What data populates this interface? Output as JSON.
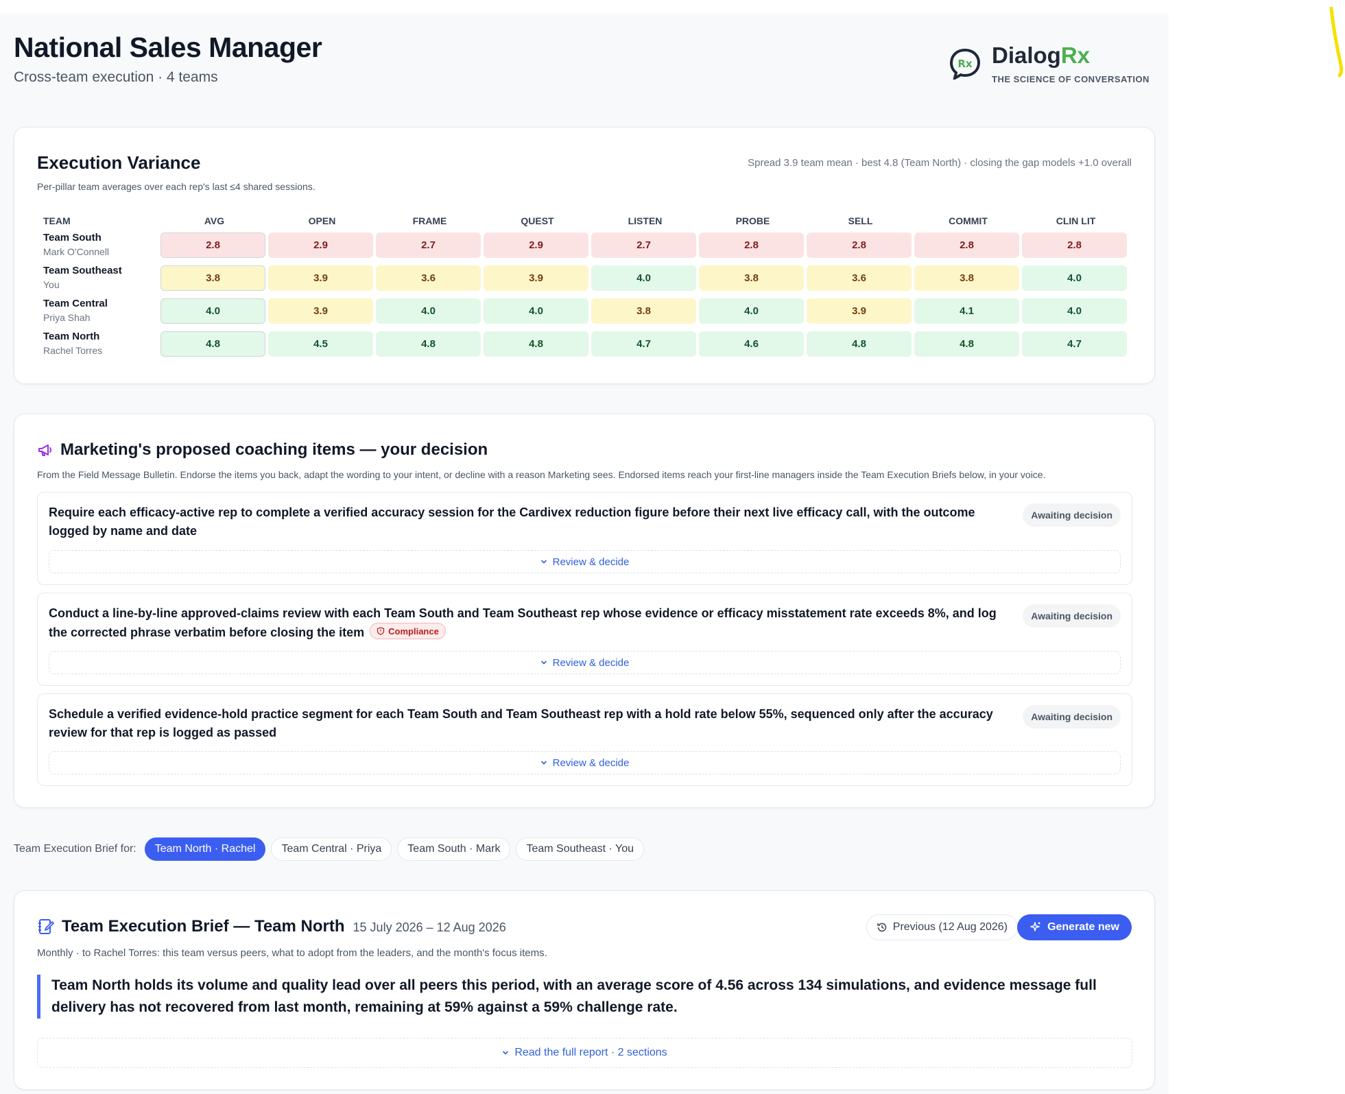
{
  "header": {
    "title": "National Sales Manager",
    "subtitle": "Cross-team execution · 4 teams",
    "logo": {
      "word_main": "Dialog",
      "word_accent": "Rx",
      "bubble_letters": "Rx",
      "tagline": "THE SCIENCE OF CONVERSATION",
      "accent_color": "#4caf50"
    }
  },
  "variance": {
    "title": "Execution Variance",
    "meta": "Spread 3.9 team mean · best 4.8 (Team North) · closing the gap models +1.0 overall",
    "description": "Per-pillar team averages over each rep's last ≤4 shared sessions.",
    "team_header": "TEAM",
    "columns": [
      "AVG",
      "OPEN",
      "FRAME",
      "QUEST",
      "LISTEN",
      "PROBE",
      "SELL",
      "COMMIT",
      "CLIN LIT"
    ],
    "rows": [
      {
        "team": "Team South",
        "manager": "Mark O'Connell",
        "values": [
          "2.8",
          "2.9",
          "2.7",
          "2.9",
          "2.7",
          "2.8",
          "2.8",
          "2.8",
          "2.8"
        ],
        "levels": [
          "r",
          "r",
          "r",
          "r",
          "r",
          "r",
          "r",
          "r",
          "r"
        ]
      },
      {
        "team": "Team Southeast",
        "manager": "You",
        "values": [
          "3.8",
          "3.9",
          "3.6",
          "3.9",
          "4.0",
          "3.8",
          "3.6",
          "3.8",
          "4.0"
        ],
        "levels": [
          "y",
          "y",
          "y",
          "y",
          "g",
          "y",
          "y",
          "y",
          "g"
        ]
      },
      {
        "team": "Team Central",
        "manager": "Priya Shah",
        "values": [
          "4.0",
          "3.9",
          "4.0",
          "4.0",
          "3.8",
          "4.0",
          "3.9",
          "4.1",
          "4.0"
        ],
        "levels": [
          "g",
          "y",
          "g",
          "g",
          "y",
          "g",
          "y",
          "g",
          "g"
        ]
      },
      {
        "team": "Team North",
        "manager": "Rachel Torres",
        "values": [
          "4.8",
          "4.5",
          "4.8",
          "4.8",
          "4.7",
          "4.6",
          "4.8",
          "4.8",
          "4.7"
        ],
        "levels": [
          "g",
          "g",
          "g",
          "g",
          "g",
          "g",
          "g",
          "g",
          "g"
        ]
      }
    ],
    "colors": {
      "low": "#fce3e3",
      "mid": "#fdf6c8",
      "high": "#e2f8e8"
    }
  },
  "marketing": {
    "icon": "megaphone-icon",
    "title": "Marketing's proposed coaching items — your decision",
    "description": "From the Field Message Bulletin. Endorse the items you back, adapt the wording to your intent, or decline with a reason Marketing sees. Endorsed items reach your first-line managers inside the Team Execution Briefs below, in your voice.",
    "items": [
      {
        "text": "Require each efficacy-active rep to complete a verified accuracy session for the Cardivex reduction figure before their next live efficacy call, with the outcome logged by name and date",
        "status": "Awaiting decision",
        "action": "Review & decide"
      },
      {
        "text": "Conduct a line-by-line approved-claims review with each Team South and Team Southeast rep whose evidence or efficacy misstatement rate exceeds 8%, and log the corrected phrase verbatim before closing the item",
        "tag": "Compliance",
        "status": "Awaiting decision",
        "action": "Review & decide"
      },
      {
        "text": "Schedule a verified evidence-hold practice segment for each Team South and Team Southeast rep with a hold rate below 55%, sequenced only after the accuracy review for that rep is logged as passed",
        "status": "Awaiting decision",
        "action": "Review & decide"
      }
    ]
  },
  "selector": {
    "label": "Team Execution Brief for:",
    "options": [
      "Team North · Rachel",
      "Team Central · Priya",
      "Team South · Mark",
      "Team Southeast · You"
    ],
    "selected": "Team North · Rachel"
  },
  "brief": {
    "icon": "notebook-pen-icon",
    "title": "Team Execution Brief — Team North",
    "dates": "15 July 2026 – 12 Aug 2026",
    "previous_label": "Previous (12 Aug 2026)",
    "generate_label": "Generate new",
    "description": "Monthly · to Rachel Torres: this team versus peers, what to adopt from the leaders, and the month's focus items.",
    "summary": "Team North holds its volume and quality lead over all peers this period, with an average score of 4.56 across 134 simulations, and evidence message full delivery has not recovered from last month, remaining at 59% against a 59% challenge rate.",
    "read_full_label": "Read the full report · 2 sections",
    "accent_color": "#3b5ef0"
  }
}
